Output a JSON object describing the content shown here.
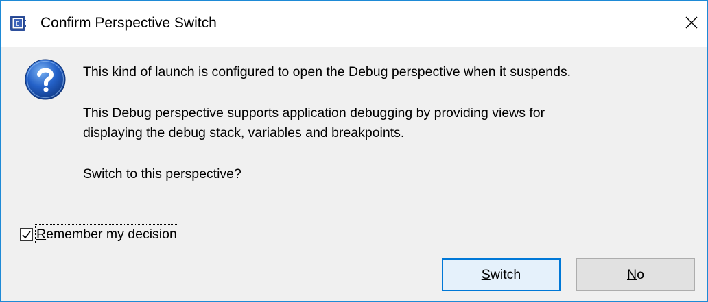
{
  "window": {
    "title": "Confirm Perspective Switch",
    "close_glyph": "×",
    "app_icon": "ide-app-icon"
  },
  "dialog": {
    "icon": "question-icon",
    "message_line1": "This kind of launch is configured to open the Debug perspective when it suspends.",
    "message_line2": "This Debug perspective supports application debugging by providing views for",
    "message_line3": "displaying the debug stack, variables and breakpoints.",
    "message_line4": "Switch to this perspective?"
  },
  "checkbox": {
    "label_mnemonic": "R",
    "label_rest": "emember my decision",
    "checked": true
  },
  "buttons": {
    "switch_mnemonic": "S",
    "switch_rest": "witch",
    "no_mnemonic": "N",
    "no_rest": "o"
  },
  "colors": {
    "window_border": "#1e8ad6",
    "dialog_background": "#f0f0f0",
    "default_button_border": "#0078d7",
    "default_button_fill": "#e5f1fb",
    "button_fill": "#e1e1e1"
  }
}
